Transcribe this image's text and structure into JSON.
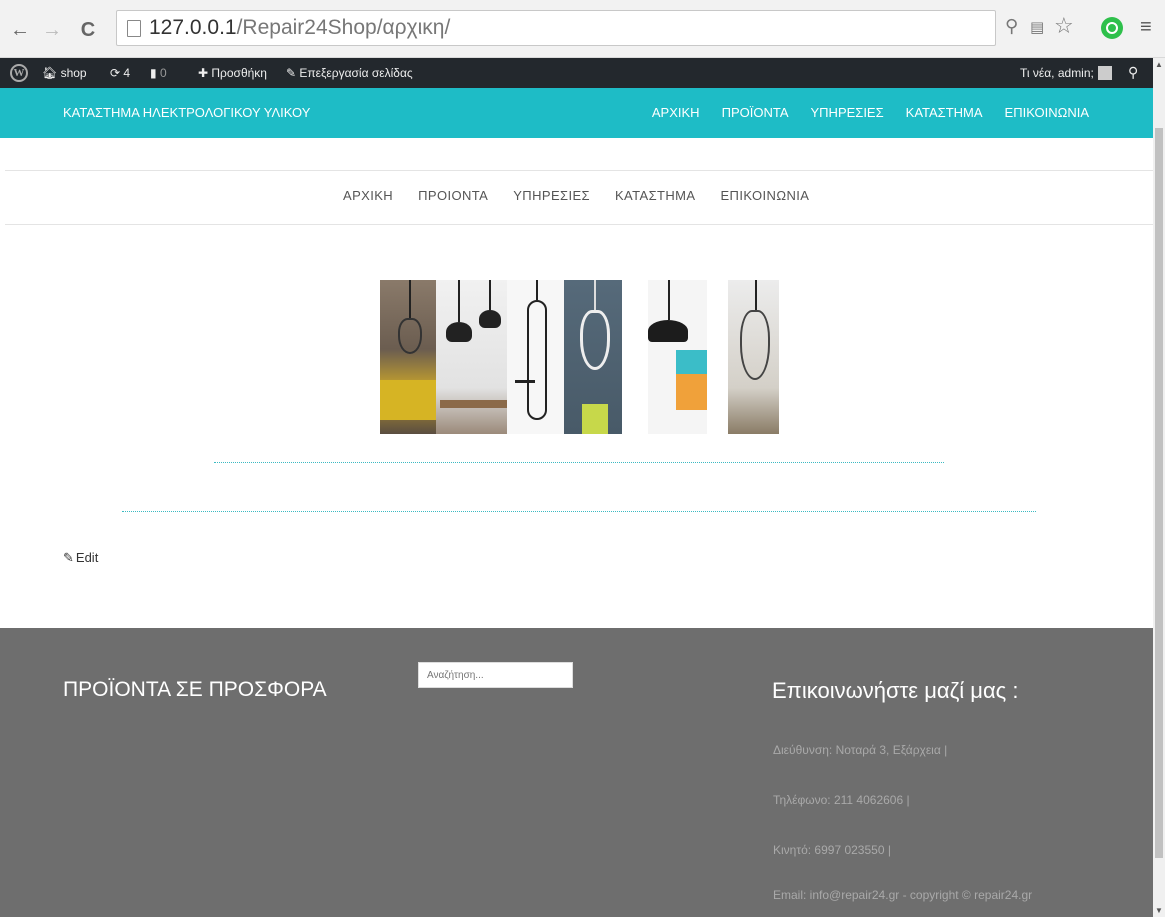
{
  "browser": {
    "url_host": "127.0.0.1",
    "url_path": "/Repair24Shop/αρχικη/"
  },
  "adminbar": {
    "site": "shop",
    "updates": "4",
    "comments": "0",
    "new": "Προσθήκη",
    "edit_page": "Επεξεργασία σελίδας",
    "greeting": "Τι νέα, admin;"
  },
  "header": {
    "site_title": "ΚΑΤΑΣΤΗΜΑ ΗΛΕΚΤΡΟΛΟΓΙΚΟΥ ΥΛΙΚΟΥ",
    "menu": [
      "ΑΡΧΙΚΗ",
      "ΠΡΟΪΟΝΤΑ",
      "ΥΠΗΡΕΣΙΕΣ",
      "ΚΑΤΑΣΤΗΜΑ",
      "ΕΠΙΚΟΙΝΩΝΙΑ"
    ]
  },
  "secondary_menu": [
    "ΑΡΧΙΚΗ",
    "ΠΡΟΙΟΝΤΑ",
    "ΥΠΗΡΕΣΙΕΣ",
    "ΚΑΤΑΣΤΗΜΑ",
    "ΕΠΙΚΟΙΝΩΝΙΑ"
  ],
  "content": {
    "edit_label": "Edit"
  },
  "footer": {
    "offers_title": "ΠΡΟΪΟΝΤΑ ΣΕ ΠΡΟΣΦΟΡΑ",
    "search_placeholder": "Αναζήτηση...",
    "contact_title": "Επικοινωνήστε μαζί μας :",
    "address": "Διεύθυνση: Νοταρά 3, Εξάρχεια |",
    "phone": "Τηλέφωνο: 211 4062606 |",
    "mobile": "Κινητό: 6997 023550 |",
    "email": "Email: info@repair24.gr - copyright © repair24.gr"
  },
  "colors": {
    "accent": "#1ebcc6",
    "adminbar": "#23282d",
    "footer": "#6e6e6e"
  }
}
